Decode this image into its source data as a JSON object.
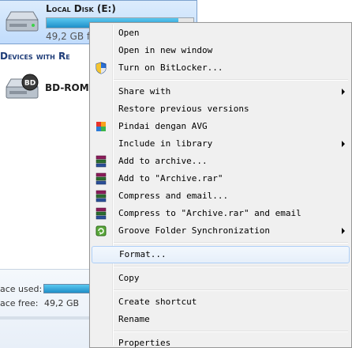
{
  "drive": {
    "title": "Local Disk (E:)",
    "free_text": "49,2 GB f",
    "used_fraction": 0.9
  },
  "section": {
    "header": "Devices with Re"
  },
  "bd_drive": {
    "label": "BD-ROM D"
  },
  "details": {
    "space_used_label": "ace used:",
    "space_free_label": "ace free:",
    "space_free_value": "49,2 GB"
  },
  "menu": {
    "items": [
      {
        "label": "Open"
      },
      {
        "label": "Open in new window"
      },
      {
        "label": "Turn on BitLocker...",
        "icon": "shield-icon"
      },
      {
        "label": "Share with",
        "submenu": true
      },
      {
        "label": "Restore previous versions"
      },
      {
        "label": "Pindai dengan AVG",
        "icon": "avg-icon"
      },
      {
        "label": "Include in library",
        "submenu": true
      },
      {
        "label": "Add to archive...",
        "icon": "winrar-icon"
      },
      {
        "label": "Add to \"Archive.rar\"",
        "icon": "winrar-icon"
      },
      {
        "label": "Compress and email...",
        "icon": "winrar-icon"
      },
      {
        "label": "Compress to \"Archive.rar\" and email",
        "icon": "winrar-icon"
      },
      {
        "label": "Groove Folder Synchronization",
        "icon": "groove-icon",
        "submenu": true
      },
      {
        "label": "Format..."
      },
      {
        "label": "Copy"
      },
      {
        "label": "Create shortcut"
      },
      {
        "label": "Rename"
      },
      {
        "label": "Properties"
      }
    ]
  }
}
